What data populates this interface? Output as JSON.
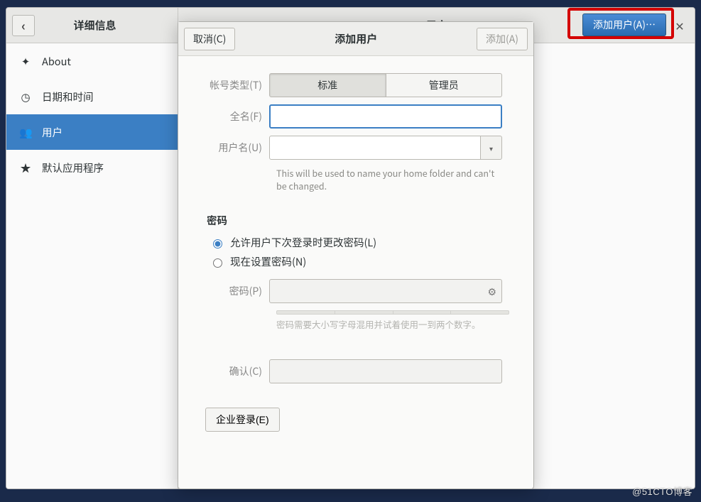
{
  "header": {
    "left_title": "详细信息",
    "right_title": "用户",
    "add_user_btn": "添加用户(A)…",
    "close_symbol": "✕",
    "back_symbol": "‹"
  },
  "sidebar": {
    "items": [
      {
        "icon": "✦",
        "label": "About"
      },
      {
        "icon": "◷",
        "label": "日期和时间"
      },
      {
        "icon": "👥",
        "label": "用户"
      },
      {
        "icon": "★",
        "label": "默认应用程序"
      }
    ],
    "selected_index": 2
  },
  "modal": {
    "cancel_label": "取消(C)",
    "title": "添加用户",
    "add_label": "添加(A)",
    "account_type_label": "帐号类型(T)",
    "account_type_options": [
      "标准",
      "管理员"
    ],
    "account_type_selected": 0,
    "fullname_label": "全名(F)",
    "fullname_value": "",
    "username_label": "用户名(U)",
    "username_value": "",
    "username_help": "This will be used to name your home folder and can't be changed.",
    "password_section": "密码",
    "pw_radio_later": "允许用户下次登录时更改密码(L)",
    "pw_radio_now": "现在设置密码(N)",
    "pw_radio_selected": "later",
    "pw_label": "密码(P)",
    "pw_value": "",
    "pw_hint": "密码需要大小写字母混用并试着使用一到两个数字。",
    "confirm_label": "确认(C)",
    "confirm_value": "",
    "enterprise_label": "企业登录(E)"
  },
  "watermark": "@51CTO博客"
}
